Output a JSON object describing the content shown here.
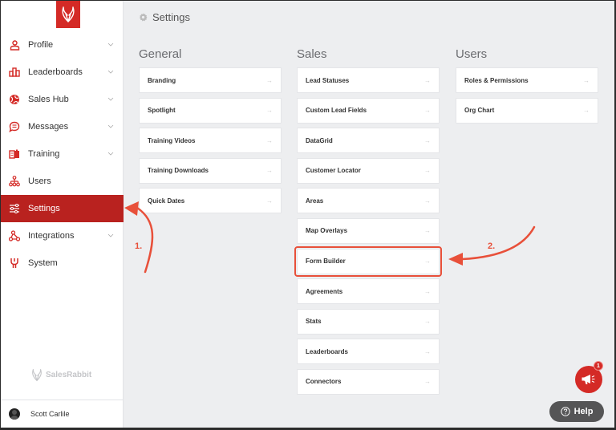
{
  "sidebar": {
    "items": [
      {
        "label": "Profile",
        "icon": "person-icon",
        "expandable": true
      },
      {
        "label": "Leaderboards",
        "icon": "podium-icon",
        "expandable": true
      },
      {
        "label": "Sales Hub",
        "icon": "globe-icon",
        "expandable": true
      },
      {
        "label": "Messages",
        "icon": "chat-bubble-icon",
        "expandable": true
      },
      {
        "label": "Training",
        "icon": "book-icon",
        "expandable": true
      },
      {
        "label": "Users",
        "icon": "org-tree-icon",
        "expandable": false
      },
      {
        "label": "Settings",
        "icon": "sliders-icon",
        "expandable": false,
        "active": true
      },
      {
        "label": "Integrations",
        "icon": "network-icon",
        "expandable": true
      },
      {
        "label": "System",
        "icon": "plug-icon",
        "expandable": false
      }
    ],
    "brand_name": "SalesRabbit",
    "user_name": "Scott Carlile"
  },
  "header": {
    "title": "Settings"
  },
  "sections": {
    "general": {
      "title": "General",
      "items": [
        "Branding",
        "Spotlight",
        "Training Videos",
        "Training Downloads",
        "Quick Dates"
      ]
    },
    "sales": {
      "title": "Sales",
      "items": [
        "Lead Statuses",
        "Custom Lead Fields",
        "DataGrid",
        "Customer Locator",
        "Areas",
        "Map Overlays",
        "Form Builder",
        "Agreements",
        "Stats",
        "Leaderboards",
        "Connectors"
      ]
    },
    "users": {
      "title": "Users",
      "items": [
        "Roles & Permissions",
        "Org Chart"
      ]
    }
  },
  "arrow_glyph": "→",
  "annotations": {
    "step1": "1.",
    "step2": "2."
  },
  "widgets": {
    "announcement_count": "1",
    "help_label": "Help"
  },
  "colors": {
    "accent": "#d42a26",
    "active_nav": "#b9221f",
    "annotation": "#e8503a"
  }
}
